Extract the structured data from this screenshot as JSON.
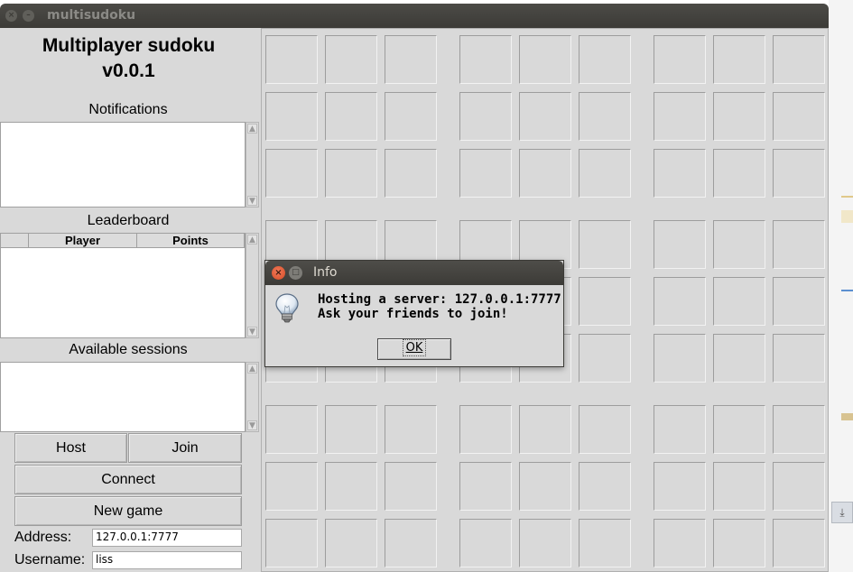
{
  "window": {
    "title": "multisudoku",
    "close_glyph": "×",
    "minimize_glyph": "–"
  },
  "left_panel": {
    "app_title_line1": "Multiplayer sudoku",
    "app_title_line2": "v0.0.1",
    "notifications_label": "Notifications",
    "leaderboard_label": "Leaderboard",
    "leaderboard_columns": [
      "Player",
      "Points"
    ],
    "sessions_label": "Available sessions",
    "buttons": {
      "host": "Host",
      "join": "Join",
      "connect": "Connect",
      "new_game": "New game"
    },
    "address_label": "Address:",
    "address_value": "127.0.0.1:7777",
    "username_label": "Username:",
    "username_value": "liss"
  },
  "board": {
    "rows": 9,
    "cols": 9
  },
  "dialog": {
    "title": "Info",
    "message_line1": "Hosting a server: 127.0.0.1:7777",
    "message_line2": "Ask your friends to join!",
    "ok_label": "OK",
    "icon": "lightbulb-icon",
    "close_glyph": "×",
    "maximize_glyph": "□"
  },
  "colors": {
    "window_bg": "#d9d9d9",
    "titlebar": "#3c3b37",
    "dialog_close": "#e05a34"
  }
}
